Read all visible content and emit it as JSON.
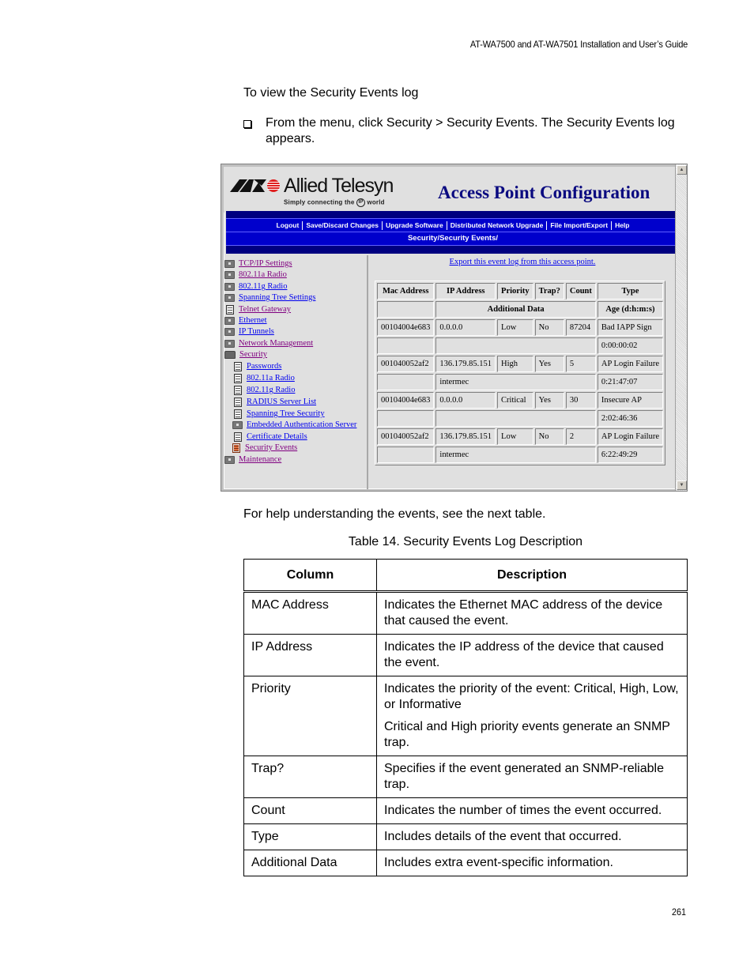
{
  "running_head": "AT-WA7500 and AT-WA7501 Installation and User’s Guide",
  "intro": "To view the Security Events log",
  "step": "From the menu, click Security > Security Events. The Security Events log appears.",
  "screenshot": {
    "logo": {
      "name": "Allied Telesyn",
      "tagline_pre": "Simply connecting the",
      "tagline_ip": "IP",
      "tagline_post": "world"
    },
    "app_title": "Access Point Configuration",
    "nav_links": [
      "Logout",
      "Save/Discard Changes",
      "Upgrade Software",
      "Distributed Network Upgrade",
      "File Import/Export",
      "Help"
    ],
    "breadcrumb": "Security/Security Events/",
    "sidebar": [
      {
        "label": "TCP/IP Settings",
        "icon": "folder-icon",
        "level": 0,
        "visited": true
      },
      {
        "label": "802.11a Radio",
        "icon": "folder-icon",
        "level": 0,
        "visited": true
      },
      {
        "label": "802.11g Radio",
        "icon": "folder-icon",
        "level": 0,
        "visited": false
      },
      {
        "label": "Spanning Tree Settings",
        "icon": "folder-icon",
        "level": 0,
        "visited": false
      },
      {
        "label": "Telnet Gateway",
        "icon": "page-icon",
        "level": 0,
        "visited": true
      },
      {
        "label": "Ethernet",
        "icon": "folder-icon",
        "level": 0,
        "visited": false
      },
      {
        "label": "IP Tunnels",
        "icon": "folder-icon",
        "level": 0,
        "visited": false
      },
      {
        "label": "Network Management",
        "icon": "folder-icon",
        "level": 0,
        "visited": true
      },
      {
        "label": "Security",
        "icon": "folder-open-icon",
        "level": 0,
        "visited": true
      },
      {
        "label": "Passwords",
        "icon": "page-icon",
        "level": 1,
        "visited": false
      },
      {
        "label": "802.11a Radio",
        "icon": "page-icon",
        "level": 1,
        "visited": false
      },
      {
        "label": "802.11g Radio",
        "icon": "page-icon",
        "level": 1,
        "visited": false
      },
      {
        "label": "RADIUS Server List",
        "icon": "page-icon",
        "level": 1,
        "visited": false
      },
      {
        "label": "Spanning Tree Security",
        "icon": "page-icon",
        "level": 1,
        "visited": false
      },
      {
        "label": "Embedded Authentication Server",
        "icon": "folder-icon",
        "level": 1,
        "visited": false
      },
      {
        "label": "Certificate Details",
        "icon": "page-icon",
        "level": 1,
        "visited": false
      },
      {
        "label": "Security Events",
        "icon": "page-icon-active",
        "level": 1,
        "visited": true
      },
      {
        "label": "Maintenance",
        "icon": "folder-icon",
        "level": 0,
        "visited": true
      }
    ],
    "export_link": "Export this event log from this access point.",
    "event_table": {
      "headers": [
        "Mac Address",
        "IP Address",
        "Priority",
        "Trap?",
        "Count",
        "Type"
      ],
      "sub_headers": {
        "additional": "Additional Data",
        "age": "Age (d:h:m:s)"
      },
      "rows": [
        {
          "mac": "00104004e683",
          "ip": "0.0.0.0",
          "priority": "Low",
          "trap": "No",
          "count": "87204",
          "type": "Bad IAPP Sign",
          "additional": "",
          "age": "0:00:00:02"
        },
        {
          "mac": "001040052af2",
          "ip": "136.179.85.151",
          "priority": "High",
          "trap": "Yes",
          "count": "5",
          "type": "AP Login Failure",
          "additional": "intermec",
          "age": "0:21:47:07"
        },
        {
          "mac": "00104004e683",
          "ip": "0.0.0.0",
          "priority": "Critical",
          "trap": "Yes",
          "count": "30",
          "type": "Insecure AP",
          "additional": "",
          "age": "2:02:46:36"
        },
        {
          "mac": "001040052af2",
          "ip": "136.179.85.151",
          "priority": "Low",
          "trap": "No",
          "count": "2",
          "type": "AP Login Failure",
          "additional": "intermec",
          "age": "6:22:49:29"
        }
      ]
    }
  },
  "help_text": "For help understanding the events, see the next table.",
  "table_caption": "Table 14. Security Events Log Description",
  "desc_table": {
    "headers": [
      "Column",
      "Description"
    ],
    "rows": [
      {
        "column": "MAC Address",
        "description": [
          "Indicates the Ethernet MAC address of the device that caused the event."
        ]
      },
      {
        "column": "IP Address",
        "description": [
          "Indicates the IP address of the device that caused the event."
        ]
      },
      {
        "column": "Priority",
        "description": [
          "Indicates the priority of the event: Critical, High, Low, or Informative",
          "Critical and High priority events generate an SNMP trap."
        ]
      },
      {
        "column": "Trap?",
        "description": [
          "Specifies if the event generated an SNMP-reliable trap."
        ]
      },
      {
        "column": "Count",
        "description": [
          "Indicates the number of times the event occurred."
        ]
      },
      {
        "column": "Type",
        "description": [
          "Includes details of the event that occurred."
        ]
      },
      {
        "column": "Additional Data",
        "description": [
          "Includes extra event-specific information."
        ]
      }
    ]
  },
  "page_number": "261",
  "colors": {
    "nav_dark": "#000080",
    "nav_bright": "#0000cc",
    "title_blue": "#0a0a80",
    "link": "#0000ee",
    "visited_link": "#800080",
    "panel_bg": "#e0e0e0"
  }
}
